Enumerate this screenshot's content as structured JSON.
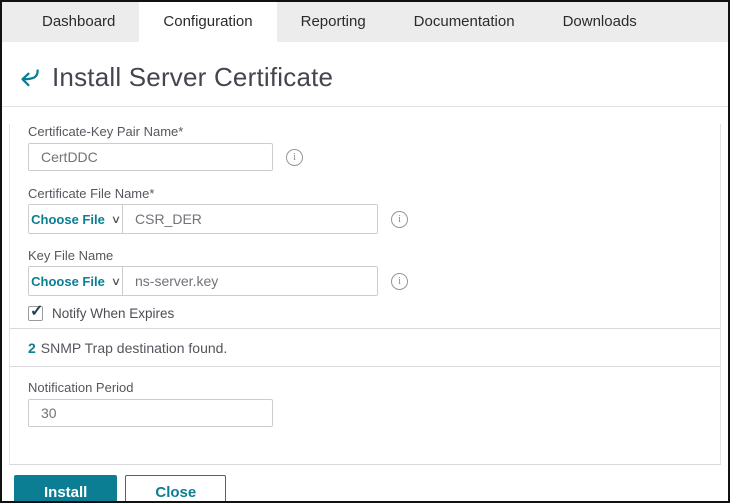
{
  "tabs": [
    {
      "label": "Dashboard",
      "active": false
    },
    {
      "label": "Configuration",
      "active": true
    },
    {
      "label": "Reporting",
      "active": false
    },
    {
      "label": "Documentation",
      "active": false
    },
    {
      "label": "Downloads",
      "active": false
    }
  ],
  "header": {
    "title": "Install Server Certificate"
  },
  "form": {
    "cert_key_pair": {
      "label": "Certificate-Key Pair Name*",
      "value": "CertDDC"
    },
    "cert_file": {
      "label": "Certificate File Name*",
      "choose_button": "Choose File",
      "value": "CSR_DER"
    },
    "key_file": {
      "label": "Key File Name",
      "choose_button": "Choose File",
      "value": "ns-server.key"
    },
    "notify": {
      "label": "Notify When Expires",
      "checked": true
    },
    "snmp_notice": {
      "count": "2",
      "text": "SNMP Trap destination found."
    },
    "notification_period": {
      "label": "Notification Period",
      "value": "30"
    }
  },
  "footer": {
    "install": "Install",
    "close": "Close"
  },
  "icons": {
    "info": "i",
    "chevron_down": "∨",
    "checkmark": "✓"
  },
  "colors": {
    "accent_teal": "#0b7e93",
    "tab_bar_bg": "#ececec",
    "title_text": "#45454e",
    "label_text": "#56565e",
    "input_text": "#72727a",
    "divider": "#d9d9d9",
    "frame_border": "#111111"
  }
}
